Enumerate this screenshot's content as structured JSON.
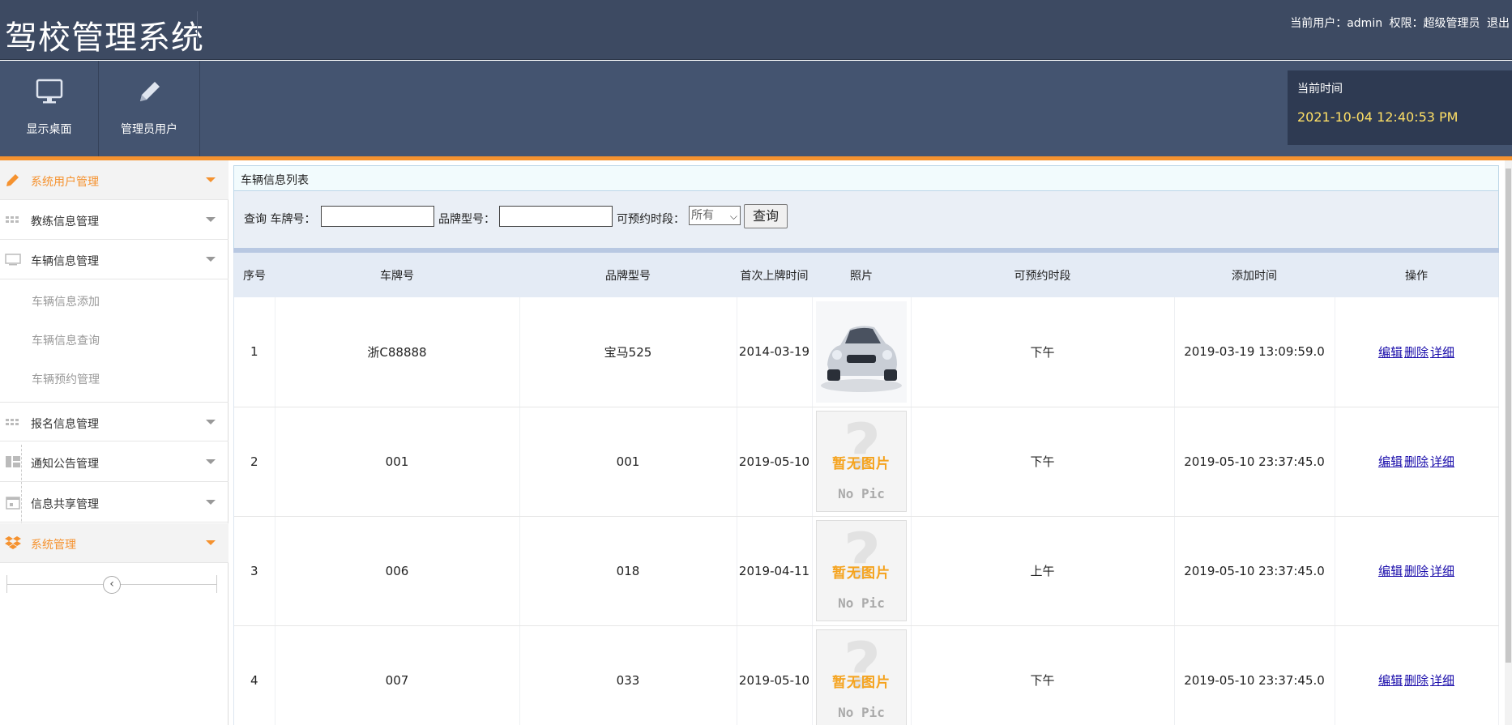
{
  "header": {
    "app_title": "驾校管理系统",
    "current_user_label": "当前用户：admin",
    "permission_label": "权限：超级管理员",
    "logout": "退出"
  },
  "nav": {
    "buttons": [
      {
        "label": "显示桌面",
        "icon": "monitor-icon"
      },
      {
        "label": "管理员用户",
        "icon": "pencil-icon"
      }
    ],
    "clock_label": "当前时间",
    "clock_value": "2021-10-04 12:40:53 PM"
  },
  "sidebar": {
    "items": [
      {
        "label": "系统用户管理",
        "icon": "pencil-icon",
        "active": true
      },
      {
        "label": "教练信息管理",
        "icon": "grid-icon"
      },
      {
        "label": "车辆信息管理",
        "icon": "monitor-icon"
      },
      {
        "label": "报名信息管理",
        "icon": "grid-icon"
      },
      {
        "label": "通知公告管理",
        "icon": "layout-icon"
      },
      {
        "label": "信息共享管理",
        "icon": "calendar-icon"
      },
      {
        "label": "系统管理",
        "icon": "dropbox-icon",
        "active": true
      }
    ],
    "sub_items": [
      {
        "label": "车辆信息添加"
      },
      {
        "label": "车辆信息查询"
      },
      {
        "label": "车辆预约管理"
      }
    ],
    "collapse": "‹"
  },
  "panel": {
    "title": "车辆信息列表",
    "search": {
      "query_label": "查询 车牌号：",
      "brand_label": "品牌型号：",
      "period_label": "可预约时段：",
      "period_selected": "所有",
      "plate_value": "",
      "brand_value": "",
      "button": "查询"
    }
  },
  "table": {
    "headers": [
      "序号",
      "车牌号",
      "品牌型号",
      "首次上牌时间",
      "照片",
      "可预约时段",
      "添加时间",
      "操作"
    ],
    "rows": [
      {
        "no": "1",
        "plate": "浙C88888",
        "brand": "宝马525",
        "first_date": "2014-03-19",
        "photo": "car",
        "period": "下午",
        "added": "2019-03-19 13:09:59.0"
      },
      {
        "no": "2",
        "plate": "001",
        "brand": "001",
        "first_date": "2019-05-10",
        "photo": "nopic",
        "period": "下午",
        "added": "2019-05-10 23:37:45.0"
      },
      {
        "no": "3",
        "plate": "006",
        "brand": "018",
        "first_date": "2019-04-11",
        "photo": "nopic",
        "period": "上午",
        "added": "2019-05-10 23:37:45.0"
      },
      {
        "no": "4",
        "plate": "007",
        "brand": "033",
        "first_date": "2019-05-10",
        "photo": "nopic",
        "period": "下午",
        "added": "2019-05-10 23:37:45.0"
      }
    ],
    "actions": {
      "edit": "编辑",
      "delete": "删除",
      "detail": "详细"
    },
    "nopic_cn": "暂无图片",
    "nopic_en": "No Pic"
  },
  "colors": {
    "header_bg": "#3d4a62",
    "nav_bg": "#445470",
    "accent": "#f5922f",
    "clock_text": "#ffe066"
  }
}
